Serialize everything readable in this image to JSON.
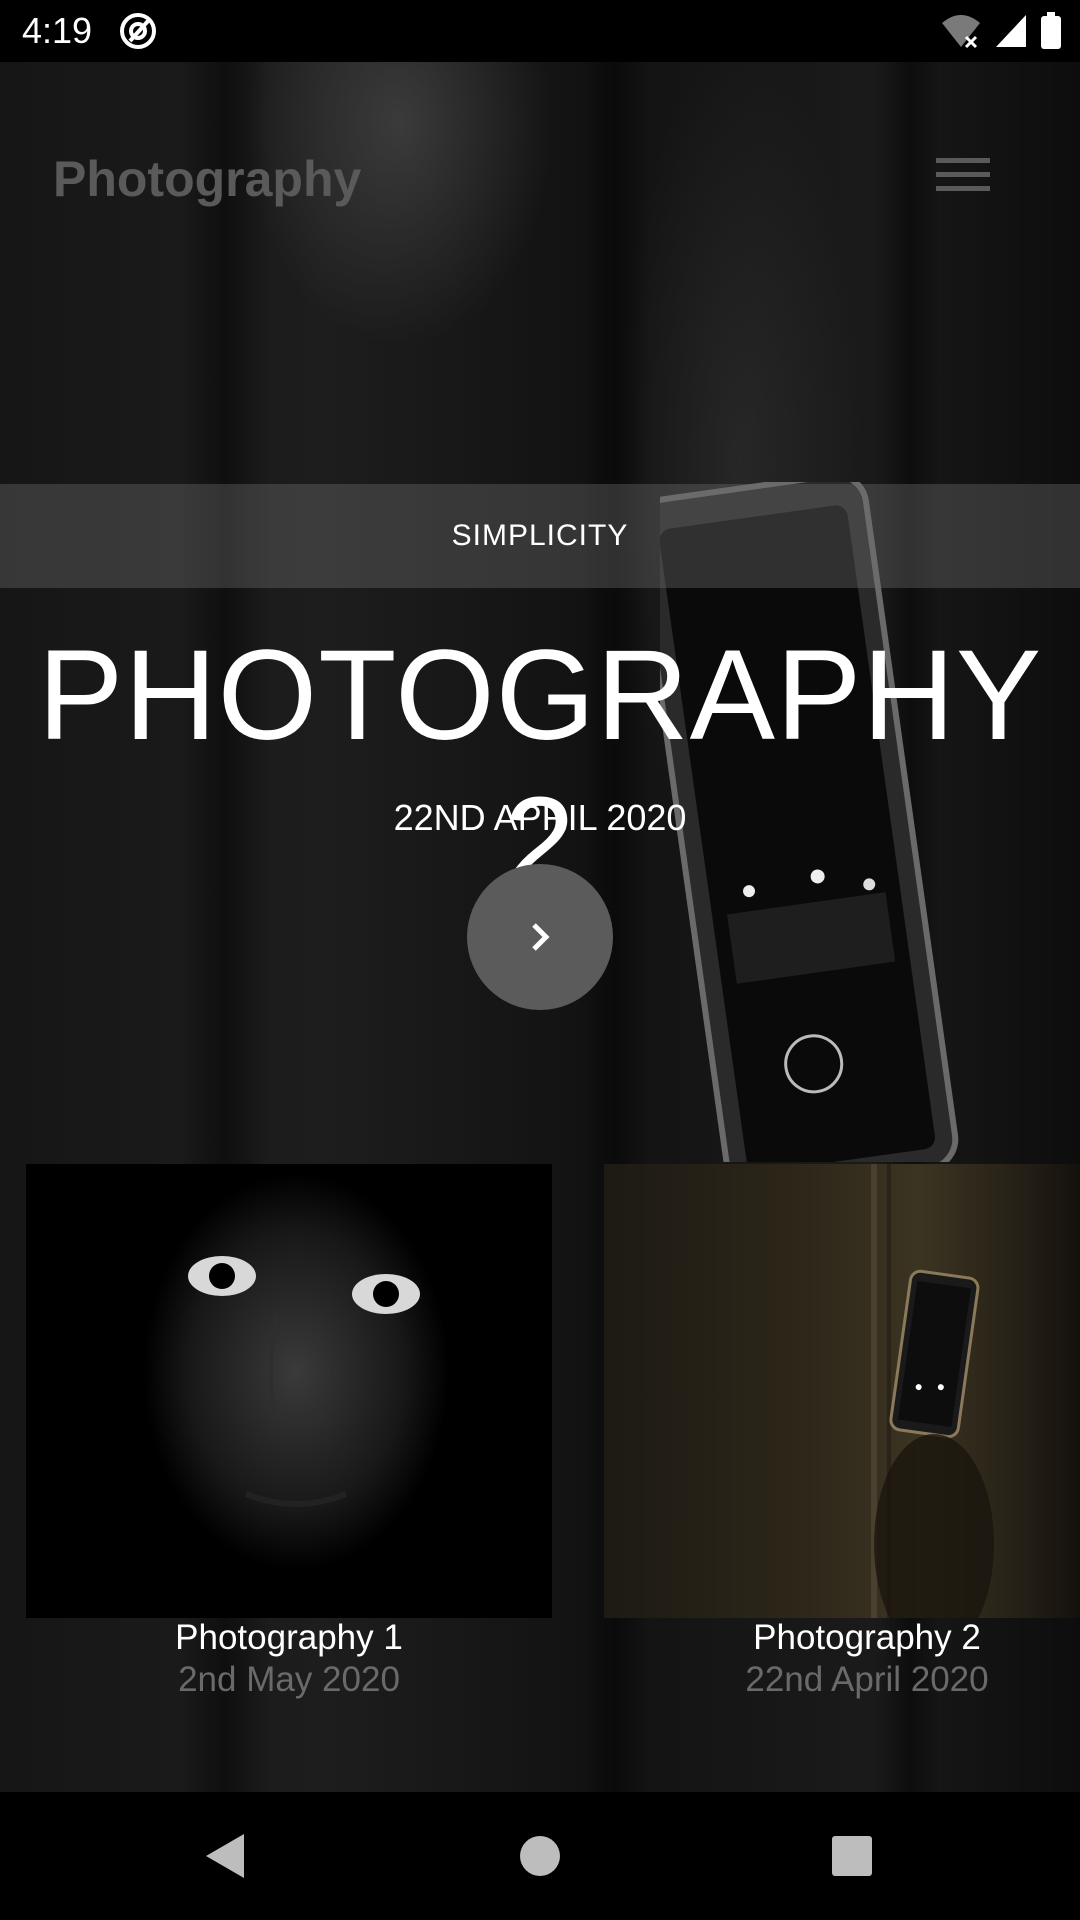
{
  "status_bar": {
    "time": "4:19",
    "icons": [
      "at-sign-icon",
      "wifi-off-icon",
      "signal-icon",
      "battery-icon"
    ]
  },
  "header": {
    "brand": "Photography",
    "menu_icon": "hamburger-menu-icon"
  },
  "hero": {
    "tag": "SIMPLICITY",
    "title": "PHOTOGRAPHY 2",
    "date": "22ND APRIL 2020",
    "next_icon": "chevron-right-icon"
  },
  "cards": [
    {
      "title": "Photography 1",
      "date": "2nd May 2020"
    },
    {
      "title": "Photography 2",
      "date": "22nd April 2020"
    }
  ],
  "nav_bar": {
    "icons": [
      "back-icon",
      "home-icon",
      "recents-icon"
    ]
  },
  "colors": {
    "brand_text": "#5a5a5a",
    "card_date": "#6a6a6a",
    "next_button": "#5b5b5b"
  }
}
